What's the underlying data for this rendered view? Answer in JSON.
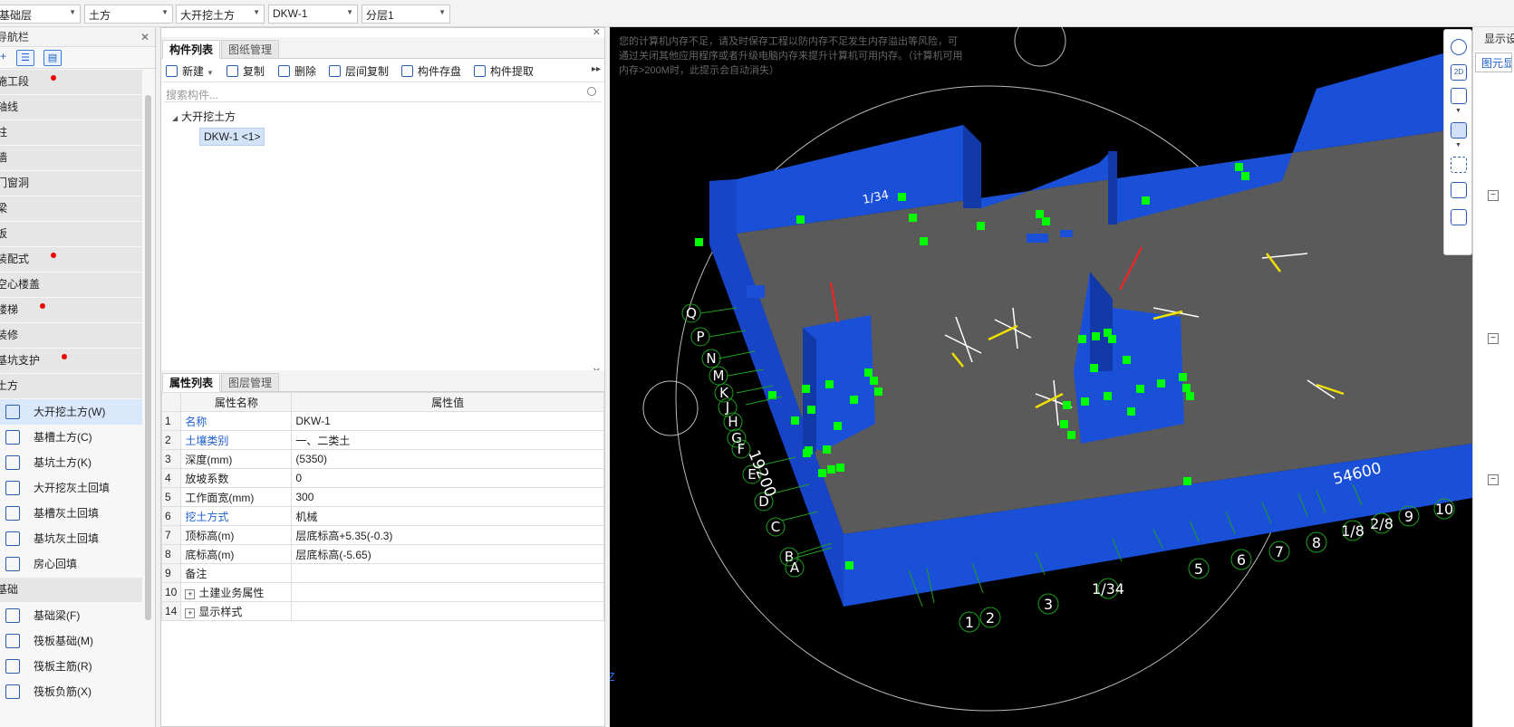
{
  "top_bar": {
    "floor": "基础层",
    "category": "土方",
    "type": "大开挖土方",
    "component": "DKW-1",
    "layer": "分层1"
  },
  "nav": {
    "title": "导航栏",
    "groups_top": [
      {
        "label": "施工段",
        "dot": true
      },
      {
        "label": "轴线",
        "dot": false
      },
      {
        "label": "柱",
        "dot": false
      },
      {
        "label": "墙",
        "dot": false
      },
      {
        "label": "门窗洞",
        "dot": false
      },
      {
        "label": "梁",
        "dot": false
      },
      {
        "label": "板",
        "dot": false
      },
      {
        "label": "装配式",
        "dot": true
      },
      {
        "label": "空心楼盖",
        "dot": false
      },
      {
        "label": "楼梯",
        "dot": true
      },
      {
        "label": "装修",
        "dot": false
      },
      {
        "label": "基坑支护",
        "dot": true
      },
      {
        "label": "土方",
        "dot": false
      }
    ],
    "earth_items": [
      {
        "label": "大开挖土方(W)",
        "icon": "excavation-icon",
        "selected": true
      },
      {
        "label": "基槽土方(C)",
        "icon": "trench-icon",
        "selected": false
      },
      {
        "label": "基坑土方(K)",
        "icon": "pit-icon",
        "selected": false
      },
      {
        "label": "大开挖灰土回填",
        "icon": "backfill-icon",
        "selected": false
      },
      {
        "label": "基槽灰土回填",
        "icon": "backfill-icon",
        "selected": false
      },
      {
        "label": "基坑灰土回填",
        "icon": "backfill-icon",
        "selected": false
      },
      {
        "label": "房心回填",
        "icon": "backfill-icon",
        "selected": false
      }
    ],
    "group_foundation": "基础",
    "foundation_items": [
      {
        "label": "基础梁(F)",
        "icon": "beam-icon"
      },
      {
        "label": "筏板基础(M)",
        "icon": "raft-icon"
      },
      {
        "label": "筏板主筋(R)",
        "icon": "rebar-icon"
      },
      {
        "label": "筏板负筋(X)",
        "icon": "rebar-icon"
      }
    ]
  },
  "component_panel": {
    "tab_active": "构件列表",
    "tab_other": "图纸管理",
    "toolbar": {
      "new": "新建",
      "copy": "复制",
      "delete": "删除",
      "layer_copy": "层间复制",
      "store": "构件存盘",
      "extract": "构件提取"
    },
    "search_placeholder": "搜索构件...",
    "tree_root": "大开挖土方",
    "tree_leaf": "DKW-1 <1>"
  },
  "property_panel": {
    "tab_active": "属性列表",
    "tab_other": "图层管理",
    "col_name": "属性名称",
    "col_value": "属性值",
    "rows": [
      {
        "num": "1",
        "name": "名称",
        "value": "DKW-1",
        "blue": true
      },
      {
        "num": "2",
        "name": "土壤类别",
        "value": "一、二类土",
        "blue": true
      },
      {
        "num": "3",
        "name": "深度(mm)",
        "value": "(5350)",
        "blue": false
      },
      {
        "num": "4",
        "name": "放坡系数",
        "value": "0",
        "blue": false
      },
      {
        "num": "5",
        "name": "工作面宽(mm)",
        "value": "300",
        "blue": false
      },
      {
        "num": "6",
        "name": "挖土方式",
        "value": "机械",
        "blue": true
      },
      {
        "num": "7",
        "name": "顶标高(m)",
        "value": "层底标高+5.35(-0.3)",
        "blue": false
      },
      {
        "num": "8",
        "name": "底标高(m)",
        "value": "层底标高(-5.65)",
        "blue": false
      },
      {
        "num": "9",
        "name": "备注",
        "value": "",
        "blue": false
      },
      {
        "num": "10",
        "name": "土建业务属性",
        "value": "",
        "blue": false,
        "expand": true
      },
      {
        "num": "14",
        "name": "显示样式",
        "value": "",
        "blue": false,
        "expand": true
      }
    ]
  },
  "viewport": {
    "warning": "您的计算机内存不足，请及时保存工程以防内存不足发生内存溢出等风险，可通过关闭其他应用程序或者升级电脑内存来提升计算机可用内存。（计算机可用内存>200M时，此提示会自动消失）",
    "axis_left": [
      "Q",
      "P",
      "N",
      "M",
      "K",
      "J",
      "H",
      "G",
      "F",
      "E",
      "D",
      "C",
      "B",
      "A"
    ],
    "axis_bottom": [
      "1",
      "2",
      "3",
      "1/34",
      "5",
      "6",
      "7",
      "8",
      "1/8",
      "2/8",
      "9",
      "10"
    ],
    "dim_left": "19200",
    "dim_bottom": "54600",
    "label_1_34_top": "1/34",
    "coord_label": "YZ"
  },
  "right_panel": {
    "title": "显示设置",
    "tab": "图元显示"
  },
  "colors": {
    "model_blue": "#1a4fd8",
    "model_floor": "#5a5a5a",
    "marker_green": "#00ff00",
    "accent": "#1f5fd0"
  }
}
